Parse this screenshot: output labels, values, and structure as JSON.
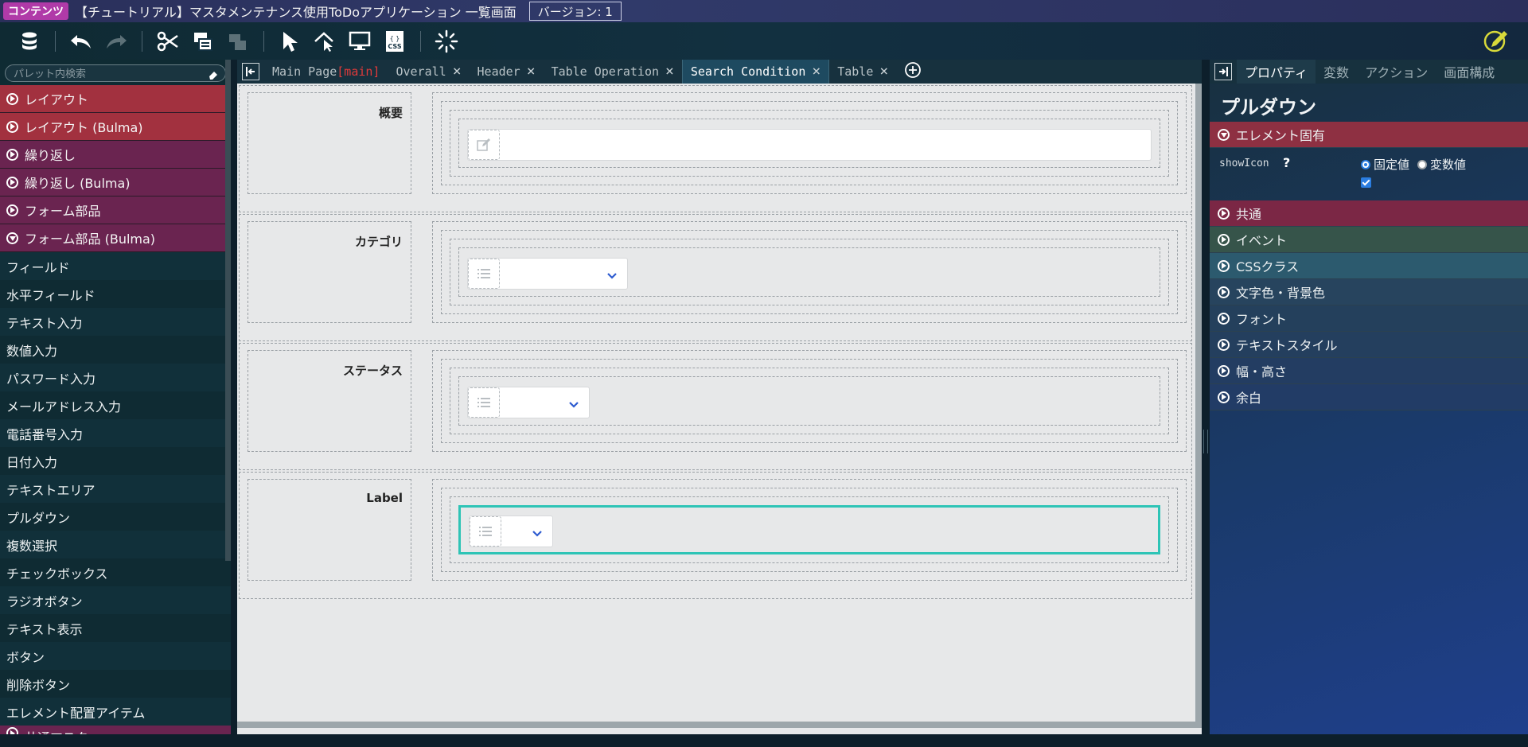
{
  "titlebar": {
    "badge": "コンテンツ",
    "app_title": "【チュートリアル】マスタメンテナンス使用ToDoアプリケーション 一覧画面",
    "version": "バージョン: 1"
  },
  "palette": {
    "search_placeholder": "パレット内検索",
    "categories": [
      {
        "label": "レイアウト"
      },
      {
        "label": "レイアウト (Bulma)"
      },
      {
        "label": "繰り返し"
      },
      {
        "label": "繰り返し (Bulma)"
      },
      {
        "label": "フォーム部品"
      },
      {
        "label": "フォーム部品 (Bulma)"
      }
    ],
    "items": [
      {
        "label": "フィールド"
      },
      {
        "label": "水平フィールド"
      },
      {
        "label": "テキスト入力"
      },
      {
        "label": "数値入力"
      },
      {
        "label": "パスワード入力"
      },
      {
        "label": "メールアドレス入力"
      },
      {
        "label": "電話番号入力"
      },
      {
        "label": "日付入力"
      },
      {
        "label": "テキストエリア"
      },
      {
        "label": "プルダウン"
      },
      {
        "label": "複数選択"
      },
      {
        "label": "チェックボックス"
      },
      {
        "label": "ラジオボタン"
      },
      {
        "label": "テキスト表示"
      },
      {
        "label": "ボタン"
      },
      {
        "label": "削除ボタン"
      },
      {
        "label": "エレメント配置アイテム"
      }
    ],
    "partial_category": "共通マスタ"
  },
  "tabs": {
    "items": [
      {
        "label": "Main Page",
        "tag": "[main]"
      },
      {
        "label": "Overall"
      },
      {
        "label": "Header"
      },
      {
        "label": "Table Operation"
      },
      {
        "label": "Search Condition"
      },
      {
        "label": "Table"
      }
    ],
    "active": "Search Condition"
  },
  "canvas": {
    "rows": [
      {
        "label": "概要",
        "control": "text"
      },
      {
        "label": "カテゴリ",
        "control": "select"
      },
      {
        "label": "ステータス",
        "control": "select"
      },
      {
        "label": "Label",
        "control": "select",
        "selected": true
      }
    ]
  },
  "props": {
    "tabs": [
      {
        "label": "プロパティ"
      },
      {
        "label": "変数"
      },
      {
        "label": "アクション"
      },
      {
        "label": "画面構成"
      }
    ],
    "title": "プルダウン",
    "element_section": "エレメント固有",
    "showIcon": {
      "name": "showIcon",
      "help": "?",
      "opt_fixed": "固定値",
      "opt_var": "変数値",
      "checked": true
    },
    "sections": [
      {
        "label": "共通"
      },
      {
        "label": "イベント"
      },
      {
        "label": "CSSクラス"
      },
      {
        "label": "文字色・背景色"
      },
      {
        "label": "フォント"
      },
      {
        "label": "テキストスタイル"
      },
      {
        "label": "幅・高さ"
      },
      {
        "label": "余白"
      }
    ]
  },
  "colors": {
    "accent_teal": "#2ec4b6",
    "category_red": "#a2313f",
    "category_purple": "#6a2450",
    "badge_magenta": "#b03aa8"
  }
}
